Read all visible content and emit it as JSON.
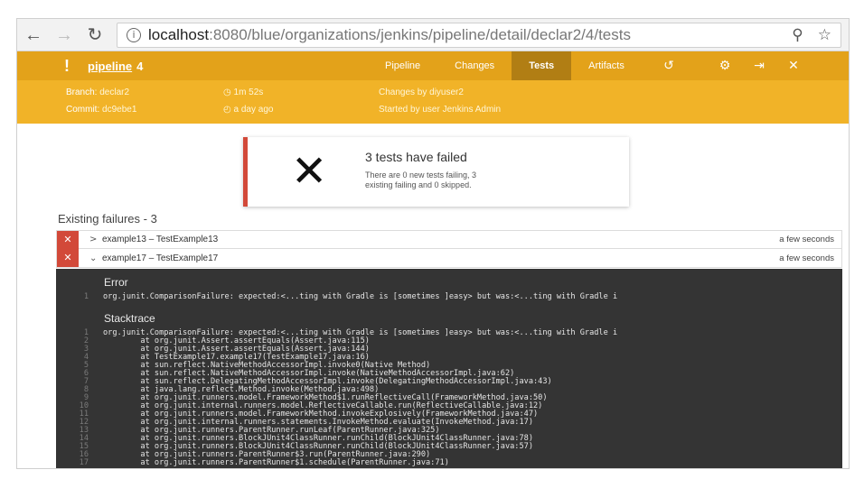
{
  "browser": {
    "url_host": "localhost",
    "url_path": ":8080/blue/organizations/jenkins/pipeline/detail/declar2/4/tests",
    "icons": [
      "back-arrow-icon",
      "forward-arrow-icon",
      "reload-icon",
      "info-icon",
      "zoom-icon",
      "star-icon"
    ]
  },
  "header": {
    "status_glyph": "!",
    "pipeline_name": "pipeline",
    "run_number": "4",
    "tabs": [
      "Pipeline",
      "Changes",
      "Tests",
      "Artifacts"
    ],
    "active_tab": "Tests",
    "accent_color": "#e3a21a"
  },
  "meta": {
    "branch_label": "Branch:",
    "branch_value": "declar2",
    "commit_label": "Commit:",
    "commit_value": "dc9ebe1",
    "duration": "1m 52s",
    "time_ago": "a day ago",
    "changes_by": "Changes by diyuser2",
    "started_by": "Started by user Jenkins Admin"
  },
  "summary": {
    "title": "3 tests have failed",
    "description": "There are 0 new tests failing, 3 existing failing and 0 skipped.",
    "fail_color": "#d24939"
  },
  "failures": {
    "section_title": "Existing failures - 3",
    "rows": [
      {
        "name": "example13 – TestExample13",
        "time": "a few seconds",
        "expanded": false
      },
      {
        "name": "example17 – TestExample17",
        "time": "a few seconds",
        "expanded": true
      }
    ]
  },
  "console": {
    "error_heading": "Error",
    "error_lines": [
      {
        "n": "1",
        "text": "org.junit.ComparisonFailure: expected:<...ting with Gradle is [sometimes ]easy> but was:<...ting with Gradle i"
      }
    ],
    "stack_heading": "Stacktrace",
    "stack_lines": [
      {
        "n": "1",
        "text": "org.junit.ComparisonFailure: expected:<...ting with Gradle is [sometimes ]easy> but was:<...ting with Gradle i"
      },
      {
        "n": "2",
        "text": "        at org.junit.Assert.assertEquals(Assert.java:115)"
      },
      {
        "n": "3",
        "text": "        at org.junit.Assert.assertEquals(Assert.java:144)"
      },
      {
        "n": "4",
        "text": "        at TestExample17.example17(TestExample17.java:16)"
      },
      {
        "n": "5",
        "text": "        at sun.reflect.NativeMethodAccessorImpl.invoke0(Native Method)"
      },
      {
        "n": "6",
        "text": "        at sun.reflect.NativeMethodAccessorImpl.invoke(NativeMethodAccessorImpl.java:62)"
      },
      {
        "n": "7",
        "text": "        at sun.reflect.DelegatingMethodAccessorImpl.invoke(DelegatingMethodAccessorImpl.java:43)"
      },
      {
        "n": "8",
        "text": "        at java.lang.reflect.Method.invoke(Method.java:498)"
      },
      {
        "n": "9",
        "text": "        at org.junit.runners.model.FrameworkMethod$1.runReflectiveCall(FrameworkMethod.java:50)"
      },
      {
        "n": "10",
        "text": "        at org.junit.internal.runners.model.ReflectiveCallable.run(ReflectiveCallable.java:12)"
      },
      {
        "n": "11",
        "text": "        at org.junit.runners.model.FrameworkMethod.invokeExplosively(FrameworkMethod.java:47)"
      },
      {
        "n": "12",
        "text": "        at org.junit.internal.runners.statements.InvokeMethod.evaluate(InvokeMethod.java:17)"
      },
      {
        "n": "13",
        "text": "        at org.junit.runners.ParentRunner.runLeaf(ParentRunner.java:325)"
      },
      {
        "n": "14",
        "text": "        at org.junit.runners.BlockJUnit4ClassRunner.runChild(BlockJUnit4ClassRunner.java:78)"
      },
      {
        "n": "15",
        "text": "        at org.junit.runners.BlockJUnit4ClassRunner.runChild(BlockJUnit4ClassRunner.java:57)"
      },
      {
        "n": "16",
        "text": "        at org.junit.runners.ParentRunner$3.run(ParentRunner.java:290)"
      },
      {
        "n": "17",
        "text": "        at org.junit.runners.ParentRunner$1.schedule(ParentRunner.java:71)"
      }
    ]
  }
}
